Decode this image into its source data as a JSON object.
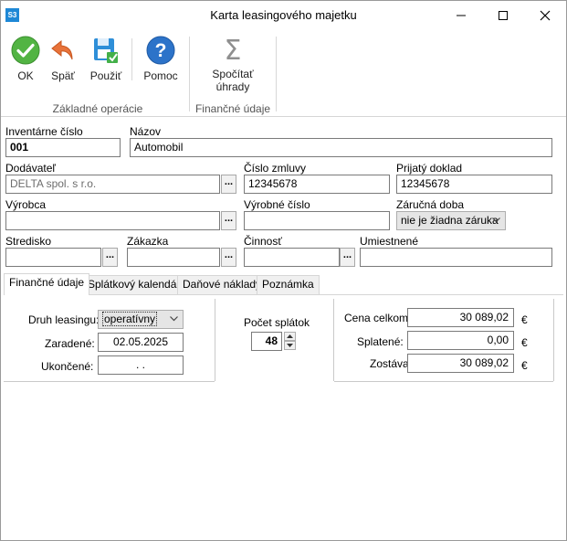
{
  "app": {
    "icon_text": "S3",
    "title": "Karta leasingového majetku"
  },
  "window_controls": {
    "minimize": "minimize",
    "maximize": "maximize",
    "close": "close"
  },
  "ribbon": {
    "ok": "OK",
    "back": "Späť",
    "apply": "Použiť",
    "help": "Pomoc",
    "calc": "Spočítať úhrady",
    "group_basic": "Základné operácie",
    "group_finance": "Finančné údaje"
  },
  "form": {
    "inventory_label": "Inventárne číslo",
    "inventory_value": "001",
    "name_label": "Názov",
    "name_value": "Automobil",
    "supplier_label": "Dodávateľ",
    "supplier_value": "DELTA spol. s r.o.",
    "contract_label": "Číslo zmluvy",
    "contract_value": "12345678",
    "received_doc_label": "Prijatý doklad",
    "received_doc_value": "12345678",
    "manufacturer_label": "Výrobca",
    "manufacturer_value": "",
    "serial_label": "Výrobné číslo",
    "serial_value": "",
    "warranty_label": "Záručná doba",
    "warranty_value": "nie je žiadna záruka",
    "center_label": "Stredisko",
    "center_value": "",
    "order_label": "Zákazka",
    "order_value": "",
    "activity_label": "Činnosť",
    "activity_value": "",
    "placement_label": "Umiestnené",
    "placement_value": "",
    "browse_label": "..."
  },
  "tabs": [
    "Finančné údaje",
    "Splátkový kalendár",
    "Daňové náklady",
    "Poznámka"
  ],
  "finance": {
    "leasing_type_label": "Druh leasingu:",
    "leasing_type_value": "operatívny",
    "assigned_label": "Zaradené:",
    "assigned_value": "02.05.2025",
    "ended_label": "Ukončené:",
    "ended_value": ".   .",
    "installments_label": "Počet splátok",
    "installments_value": "48",
    "price_total_label": "Cena celkom:",
    "price_total_value": "30 089,02",
    "paid_label": "Splatené:",
    "paid_value": "0,00",
    "remaining_label": "Zostáva",
    "remaining_value": "30 089,02",
    "currency": "€"
  }
}
